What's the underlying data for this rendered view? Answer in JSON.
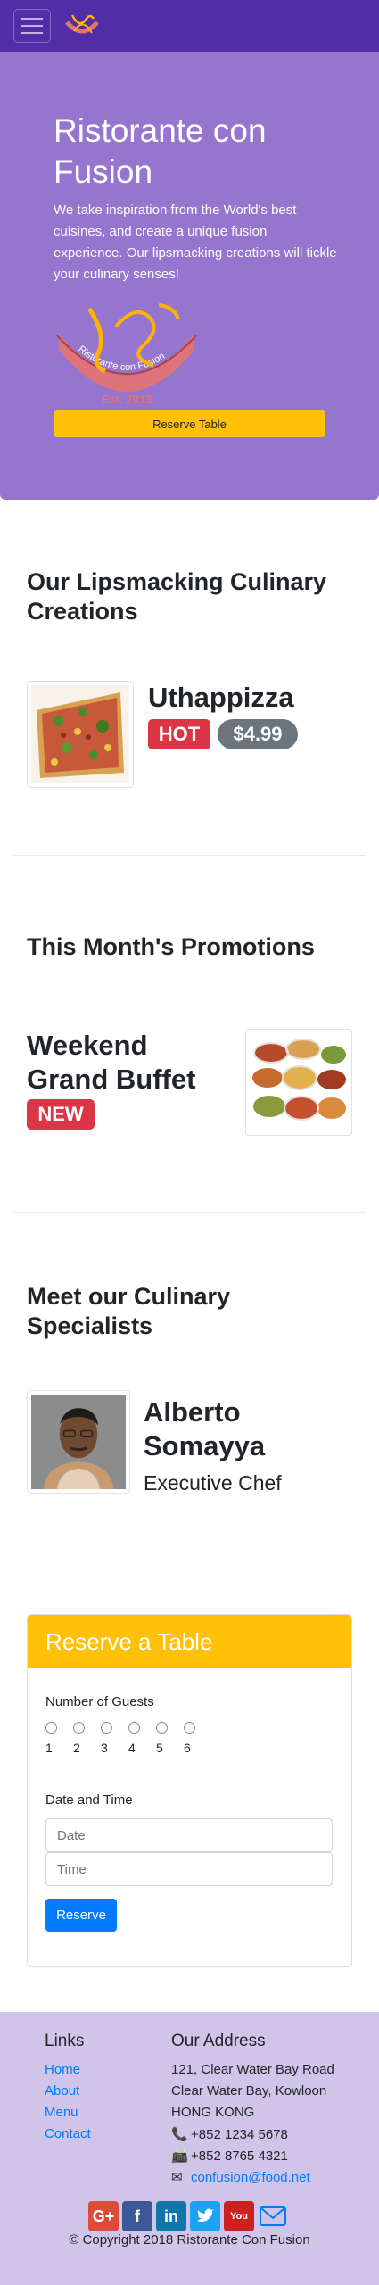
{
  "navbar": {
    "toggler_icon": "menu-icon",
    "logo_icon": "restaurant-logo-icon"
  },
  "jumbotron": {
    "title": "Ristorante con Fusion",
    "text": "We take inspiration from the World's best cuisines, and create a unique fusion experience. Our lipsmacking creations will tickle your culinary senses!",
    "logo_banner_text": "Ristorante con Fusion",
    "logo_est_text": "Est. 2013",
    "reserve_button": "Reserve Table"
  },
  "dish_section": {
    "title": "Our Lipsmacking Culinary Creations",
    "name": "Uthappizza",
    "badge": "HOT",
    "price": "$4.99"
  },
  "promo_section": {
    "title": "This Month's Promotions",
    "name": "Weekend Grand Buffet",
    "badge": "NEW"
  },
  "chef_section": {
    "title": "Meet our Culinary Specialists",
    "name": "Alberto Somayya",
    "designation": "Executive Chef"
  },
  "reservation": {
    "header": "Reserve a Table",
    "guests_label": "Number of Guests",
    "guest_options": [
      "1",
      "2",
      "3",
      "4",
      "5",
      "6"
    ],
    "datetime_label": "Date and Time",
    "date_placeholder": "Date",
    "time_placeholder": "Time",
    "submit": "Reserve"
  },
  "footer": {
    "links_title": "Links",
    "links": [
      "Home",
      "About",
      "Menu",
      "Contact"
    ],
    "address_title": "Our Address",
    "address_lines": [
      "121, Clear Water Bay Road",
      "Clear Water Bay, Kowloon",
      "HONG KONG"
    ],
    "phone": "+852 1234 5678",
    "fax": "+852 8765 4321",
    "email": "confusion@food.net",
    "social_icons": [
      "google-plus-icon",
      "facebook-icon",
      "linkedin-icon",
      "twitter-icon",
      "youtube-icon",
      "mail-icon"
    ],
    "copyright": "© Copyright 2018 Ristorante Con Fusion"
  },
  "colors": {
    "navbar": "#512da8",
    "jumbotron": "#9575cd",
    "footer": "#d1c4e9",
    "warning": "#ffc107",
    "danger": "#dc3545",
    "primary": "#007bff"
  }
}
